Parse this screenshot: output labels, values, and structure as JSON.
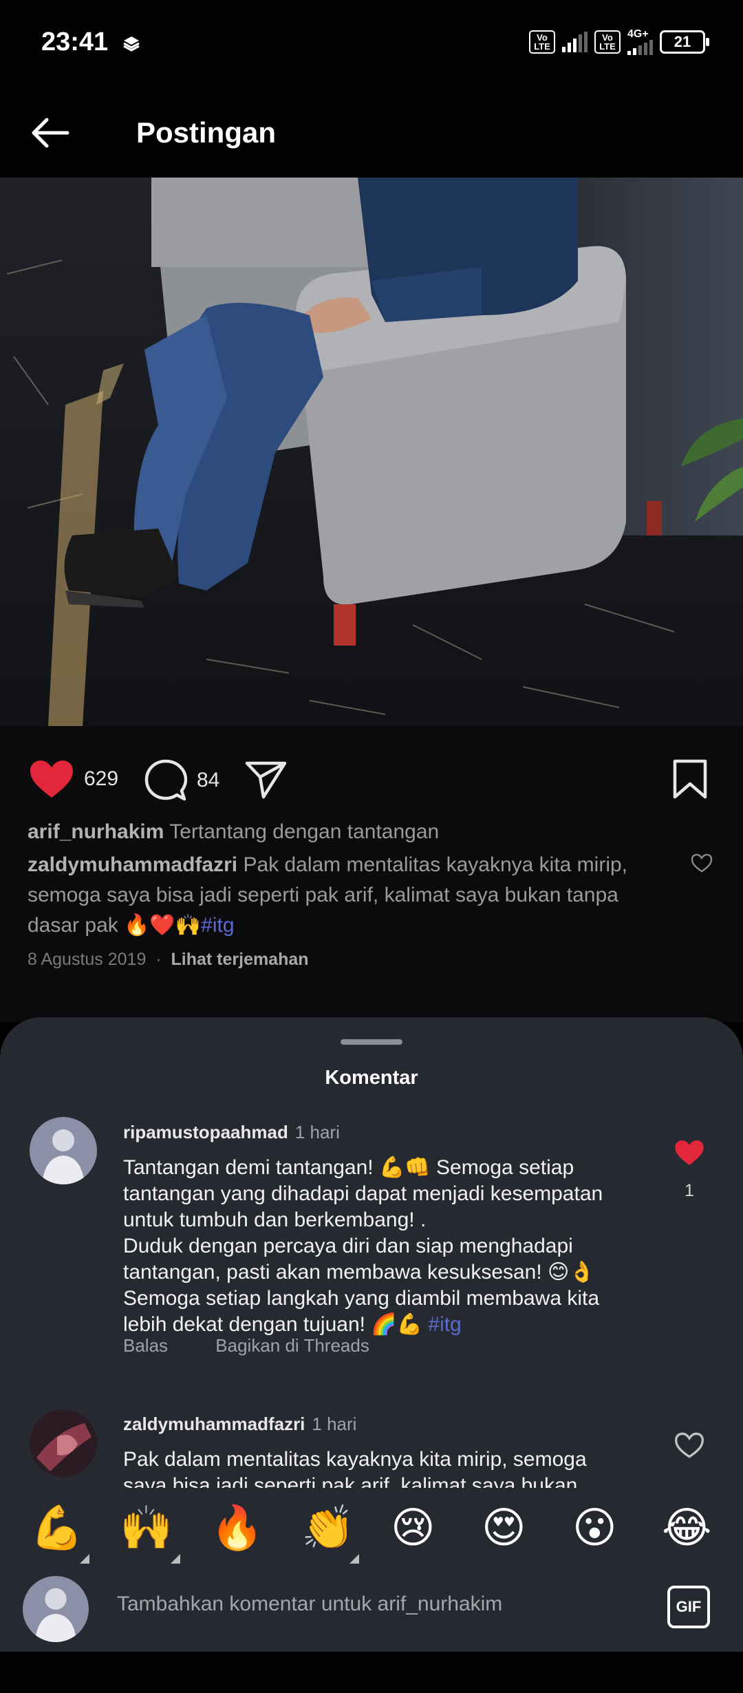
{
  "status": {
    "time": "23:41",
    "volte1": "Vo LTE",
    "volte2": "Vo LTE",
    "network": "4G+",
    "battery": "21"
  },
  "header": {
    "title": "Postingan"
  },
  "post": {
    "likes": "629",
    "comments": "84",
    "author": "arif_nurhakim",
    "caption": "Tertantang dengan tantangan",
    "top_comment": {
      "user": "zaldymuhammadfazri",
      "text": "Pak dalam mentalitas kayaknya kita mirip, semoga saya bisa jadi seperti pak arif, kalimat saya bukan tanpa dasar pak 🔥❤️🙌",
      "hashtag": "#itg"
    },
    "date": "8 Agustus 2019",
    "translate": "Lihat terjemahan"
  },
  "sheet": {
    "title": "Komentar",
    "comments": [
      {
        "user": "ripamustopaahmad",
        "time": "1 hari",
        "lines": [
          "Tantangan demi tantangan! 💪👊 Semoga setiap",
          "tantangan yang dihadapi dapat menjadi kesempatan",
          "untuk tumbuh dan berkembang! .",
          "Duduk dengan percaya diri dan siap menghadapi",
          "tantangan, pasti akan membawa kesuksesan! 😊👌",
          "Semoga setiap langkah yang diambil membawa kita",
          "lebih dekat dengan tujuan! 🌈💪"
        ],
        "hashtag": "#itg",
        "reply": "Balas",
        "share": "Bagikan di Threads",
        "likes": "1"
      },
      {
        "user": "zaldymuhammadfazri",
        "time": "1 hari",
        "lines": [
          "Pak dalam mentalitas kayaknya kita mirip, semoga",
          "saya bisa jadi seperti pak arif, kalimat saya bukan"
        ]
      }
    ]
  },
  "emoji_bar": [
    "💪",
    "🙌",
    "🔥",
    "👏",
    "😢",
    "😍",
    "😮",
    "😂"
  ],
  "input": {
    "placeholder": "Tambahkan komentar untuk arif_nurhakim",
    "gif_label": "GIF"
  },
  "colors": {
    "like_red": "#e3273a",
    "hashtag": "#5b6bd1",
    "sheet_bg": "#262a30"
  }
}
